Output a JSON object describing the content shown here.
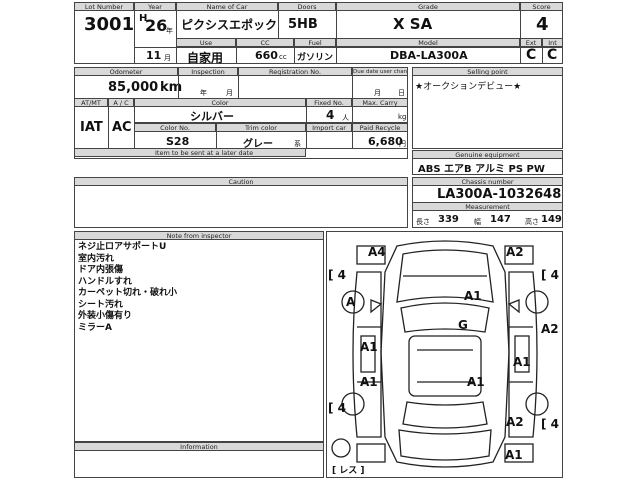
{
  "headers": {
    "lot_number": "Lot Number",
    "year": "Year",
    "name_of_car": "Name of Car",
    "doors": "Doors",
    "grade": "Grade",
    "score": "Score",
    "use": "Use",
    "cc": "CC",
    "fuel": "Fuel",
    "model": "Model",
    "ext": "Ext",
    "int": "Int",
    "odometer": "Odometer",
    "inspection": "Inspection",
    "registration_no": "Registration No.",
    "due_date_change": "Due date user change",
    "selling_point": "Selling point",
    "at_mt": "AT/MT",
    "a_c": "A / C",
    "color": "Color",
    "fixed_no": "Fixed No.",
    "max_carry": "Max. Carry",
    "color_no": "Color No.",
    "trim_color": "Trim color",
    "import_car": "Import car",
    "paid_recycle": "Paid Recycle",
    "item_to_be_sent": "Item to be sent at a later date",
    "genuine_equipment": "Genuine equipment",
    "caution": "Caution",
    "chassis_number": "Chassis number",
    "measurement": "Measurement",
    "note_from_inspector": "Note from inspector",
    "information": "Information"
  },
  "vehicle": {
    "lot_number": "3001",
    "year_era": "H",
    "year": "26",
    "year_unit": "年",
    "name": "ピクシスエポック",
    "doors": "5HB",
    "grade": "X SA",
    "score": "4",
    "use": "自家用",
    "month": "11",
    "month_unit": "月",
    "cc": "660",
    "cc_unit": "cc",
    "fuel": "ガソリン",
    "model": "DBA-LA300A",
    "ext": "C",
    "int": "C",
    "odometer": "85,000",
    "odometer_unit": "km",
    "inspection_year_unit": "年",
    "inspection_month_unit": "月",
    "due_month_unit": "月",
    "due_day_unit": "日",
    "selling_point": "★オークションデビュー★",
    "transmission": "IAT",
    "ac": "AC",
    "color": "シルバー",
    "fixed_no": "4",
    "fixed_no_unit": "人",
    "max_carry_unit": "kg",
    "color_no": "S28",
    "trim_color": "グレー",
    "trim_color_unit": "系",
    "paid_recycle": "6,680",
    "paid_recycle_unit": "円",
    "genuine_equipment": "ABS エアB アルミ PS PW",
    "chassis_number": "LA300A-1032648",
    "length_label": "長さ",
    "length": "339",
    "width_label": "幅",
    "width": "147",
    "height_label": "高さ",
    "height": "149"
  },
  "inspector_notes": [
    "ネジ止ロアサポートU",
    "室内汚れ",
    "ドア内張傷",
    "ハンドルすれ",
    "カーペット切れ・破れ小",
    "シート汚れ",
    "外装小傷有り",
    "ミラーA"
  ],
  "diagram": {
    "marks": {
      "front_left_corner": "A4",
      "front_right_corner": "A2",
      "left_front_tire": "4",
      "right_front_tire": "4",
      "left_front_door": "A",
      "hood": "A1",
      "roof": "G",
      "right_front_fender": "A2",
      "left_rear_door": "A1",
      "right_door": "A1",
      "left_rear_fender": "A1",
      "right_rear_fender": "A1",
      "left_rear_tire": "4",
      "right_rear_tire": "4",
      "rear_right_corner": "A2",
      "trunk": "A1",
      "spare": "レス"
    }
  }
}
